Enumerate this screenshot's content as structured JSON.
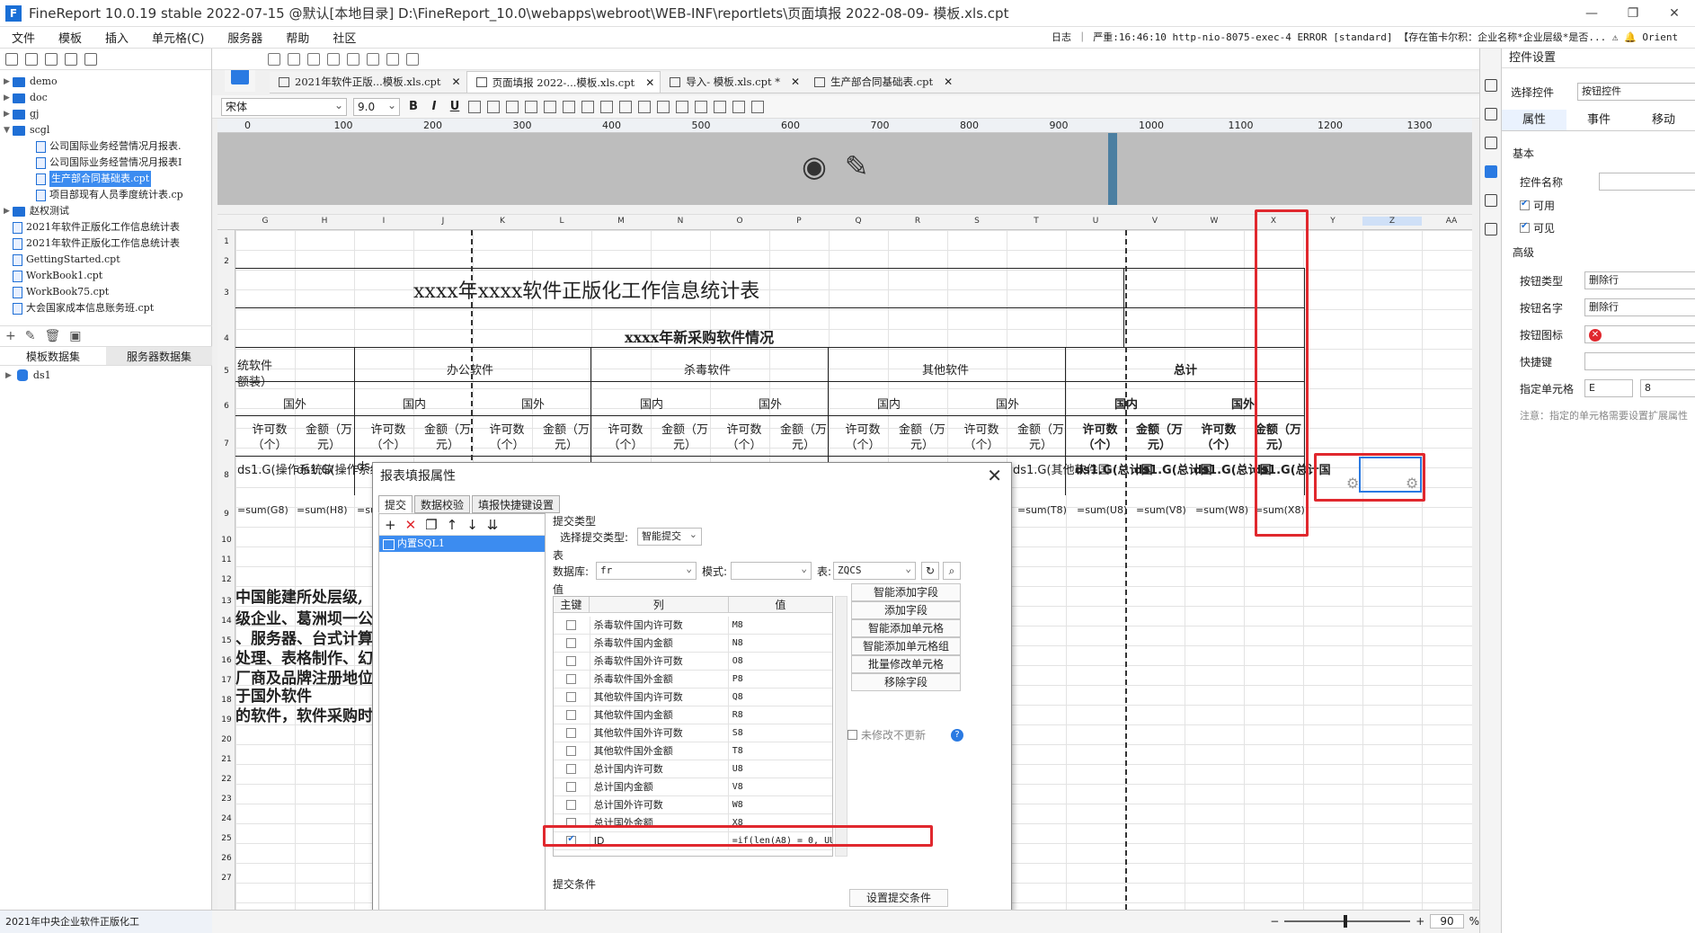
{
  "window": {
    "title": "FineReport 10.0.19 stable 2022-07-15 @默认[本地目录]    D:\\FineReport_10.0\\webapps\\webroot\\WEB-INF\\reportlets\\页面填报 2022-08-09- 模板.xls.cpt",
    "min": "—",
    "max": "❐",
    "close": "✕"
  },
  "menu": {
    "items": [
      "文件",
      "模板",
      "插入",
      "单元格(C)",
      "服务器",
      "帮助",
      "社区"
    ],
    "log": "日志 ｜ 严重:16:46:10 http-nio-8075-exec-4 ERROR [standard] 【存在笛卡尔积：企业名称*企业层级*是否... ⚠ 🔔 Orient"
  },
  "tree": {
    "nodes": [
      {
        "label": "demo",
        "kind": "folder",
        "level": 0
      },
      {
        "label": "doc",
        "kind": "folder",
        "level": 0
      },
      {
        "label": "gj",
        "kind": "folder",
        "level": 0
      },
      {
        "label": "scgl",
        "kind": "folder",
        "level": 0
      },
      {
        "label": "公司国际业务经营情况月报表.",
        "kind": "file",
        "level": 1
      },
      {
        "label": "公司国际业务经营情况月报表I",
        "kind": "file",
        "level": 1
      },
      {
        "label": "生产部合同基础表.cpt",
        "kind": "file",
        "level": 1,
        "selected": true
      },
      {
        "label": "项目部现有人员季度统计表.cp",
        "kind": "file",
        "level": 1
      },
      {
        "label": "赵权测试",
        "kind": "folder",
        "level": 0
      },
      {
        "label": "2021年软件正版化工作信息统计表",
        "kind": "file",
        "level": 0
      },
      {
        "label": "2021年软件正版化工作信息统计表",
        "kind": "file",
        "level": 0
      },
      {
        "label": "GettingStarted.cpt",
        "kind": "file",
        "level": 0
      },
      {
        "label": "WorkBook1.cpt",
        "kind": "file",
        "level": 0
      },
      {
        "label": "WorkBook75.cpt",
        "kind": "file",
        "level": 0
      },
      {
        "label": "大会国家成本信息账务班.cpt",
        "kind": "file",
        "level": 0
      }
    ]
  },
  "dataset": {
    "tabs": [
      "模板数据集",
      "服务器数据集"
    ],
    "item": "ds1"
  },
  "tabs": [
    {
      "label": "2021年软件正版...模板.xls.cpt",
      "active": false
    },
    {
      "label": "页面填报 2022-...模板.xls.cpt",
      "active": true
    },
    {
      "label": "导入- 模板.xls.cpt *",
      "active": false
    },
    {
      "label": "生产部合同基础表.cpt",
      "active": false
    }
  ],
  "format": {
    "font": "宋体",
    "size": "9.0"
  },
  "ruler": [
    "0",
    "100",
    "200",
    "300",
    "400",
    "500",
    "600",
    "700",
    "800",
    "900",
    "1000",
    "1100",
    "1200",
    "1300"
  ],
  "columns": [
    "G",
    "H",
    "I",
    "J",
    "K",
    "L",
    "M",
    "N",
    "O",
    "P",
    "Q",
    "R",
    "S",
    "T",
    "U",
    "V",
    "W",
    "X",
    "Y",
    "Z",
    "AA"
  ],
  "rows": [
    "1",
    "2",
    "3",
    "4",
    "5",
    "6",
    "7",
    "8",
    "9",
    "10",
    "11",
    "12",
    "13",
    "14",
    "15",
    "16",
    "17",
    "18",
    "19",
    "20",
    "21",
    "22",
    "23",
    "24",
    "25",
    "26",
    "27"
  ],
  "report": {
    "title": "xxxx年xxxx软件正版化工作信息统计表",
    "subtitle": "xxxx年新采购软件情况",
    "row5": {
      "a": "统软件",
      "a2": "额装）",
      "office": "办公软件",
      "antivirus": "杀毒软件",
      "other": "其他软件",
      "total": "总计"
    },
    "row6": [
      "国外",
      "国内",
      "国外",
      "国内",
      "国外",
      "国内",
      "国外",
      "国内",
      "国外"
    ],
    "row7_count": "许可数（个）",
    "row7_amount": "金额（万元）",
    "row8": [
      "ds1.G(操作系统软",
      "ds1.G(操作系统软",
      "ds",
      "ds1.G(其他软件国",
      "ds1.G(总计国",
      "ds1.G(总计国",
      "ds1.G(总计国",
      "ds1.G(总计国"
    ],
    "row9": [
      "=sum(G8)",
      "=sum(H8)",
      "=su",
      "=sum(T8)",
      "=sum(U8)",
      "=sum(V8)",
      "=sum(W8)",
      "=sum(X8)"
    ],
    "notes": [
      "中国能建所处层级,",
      "级企业、葛洲坝一公",
      "、服务器、台式计算",
      "处理、表格制作、幻",
      "厂商及品牌注册地位",
      "于国外软件",
      "的软件，软件采购时"
    ]
  },
  "dialog": {
    "title": "报表填报属性",
    "close": "✕",
    "tabs": [
      "提交",
      "数据校验",
      "填报快捷键设置"
    ],
    "left_item": "内置SQL1",
    "submit_type_section": "提交类型",
    "select_submit_type": "选择提交类型:",
    "submit_type": "智能提交",
    "table_section": "表",
    "db_label": "数据库:",
    "db_value": "fr",
    "mode_label": "模式:",
    "mode_value": "",
    "table_label": "表:",
    "table_value": "ZQCS",
    "value_section": "值",
    "headers": [
      "主键",
      "列",
      "值"
    ],
    "rows": [
      {
        "col": "杀毒软件国内许可数",
        "val": "M8",
        "checked": false
      },
      {
        "col": "杀毒软件国内金额",
        "val": "N8",
        "checked": false
      },
      {
        "col": "杀毒软件国外许可数",
        "val": "O8",
        "checked": false
      },
      {
        "col": "杀毒软件国外金额",
        "val": "P8",
        "checked": false
      },
      {
        "col": "其他软件国内许可数",
        "val": "Q8",
        "checked": false
      },
      {
        "col": "其他软件国内金额",
        "val": "R8",
        "checked": false
      },
      {
        "col": "其他软件国外许可数",
        "val": "S8",
        "checked": false
      },
      {
        "col": "其他软件国外金额",
        "val": "T8",
        "checked": false
      },
      {
        "col": "总计国内许可数",
        "val": "U8",
        "checked": false
      },
      {
        "col": "总计国内金额",
        "val": "V8",
        "checked": false
      },
      {
        "col": "总计国外许可数",
        "val": "W8",
        "checked": false
      },
      {
        "col": "总计国外金额",
        "val": "X8",
        "checked": false
      },
      {
        "col": "ID",
        "val": "=if(len(A8) = 0, UUID(...",
        "checked": true
      }
    ],
    "buttons": [
      "智能添加字段",
      "添加字段",
      "智能添加单元格",
      "智能添加单元格组",
      "批量修改单元格",
      "移除字段"
    ],
    "no_update": "未修改不更新",
    "condition_section": "提交条件",
    "condition_button": "设置提交条件"
  },
  "props": {
    "title": "控件设置",
    "select_label": "选择控件",
    "select_value": "按钮控件",
    "tabs": [
      "属性",
      "事件",
      "移动"
    ],
    "basic": "基本",
    "name_label": "控件名称",
    "enabled": "可用",
    "visible": "可见",
    "advanced": "高级",
    "button_type_label": "按钮类型",
    "button_type": "删除行",
    "button_name_label": "按钮名字",
    "button_name": "删除行",
    "button_icon_label": "按钮图标",
    "shortcut_label": "快捷键",
    "cell_label": "指定单元格",
    "cell_col": "E",
    "cell_row": "8",
    "note": "注意：指定的单元格需要设置扩展属性"
  },
  "status": {
    "sheet": "2021年中央企业软件正版化工",
    "zoom": "90"
  }
}
